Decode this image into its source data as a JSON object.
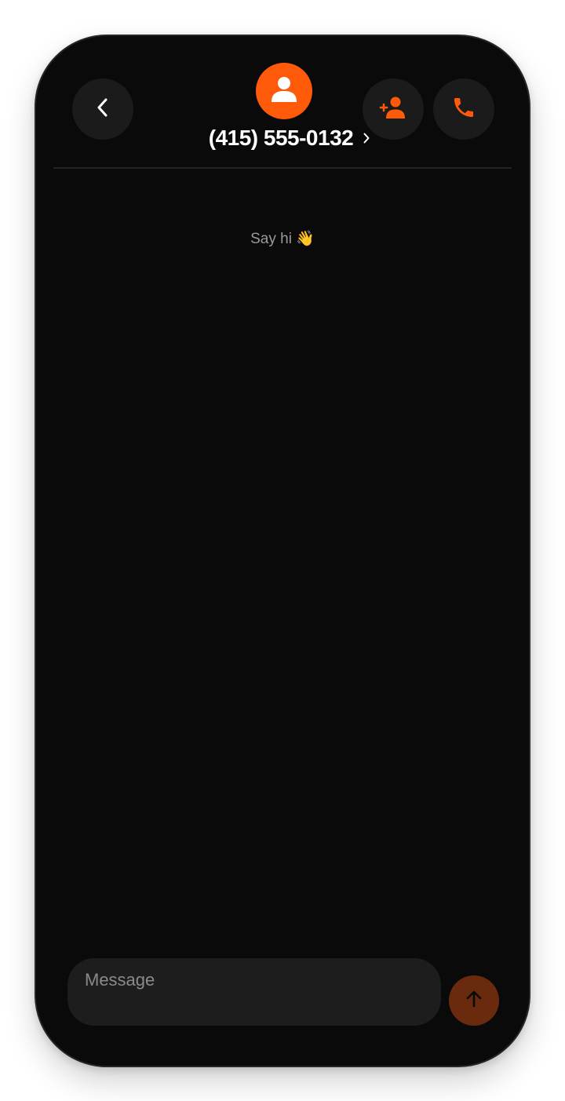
{
  "header": {
    "contact_name": "(415) 555-0132",
    "back_icon": "chevron-left-icon",
    "avatar_icon": "person-icon",
    "add_contact_icon": "person-add-icon",
    "call_icon": "phone-icon",
    "name_chevron_icon": "chevron-right-icon"
  },
  "conversation": {
    "empty_hint": "Say hi 👋"
  },
  "composer": {
    "placeholder": "Message",
    "value": "",
    "send_icon": "arrow-up-icon"
  },
  "colors": {
    "accent": "#ff5a0a",
    "background": "#0a0a0a",
    "button_bg": "#1b1b1c",
    "send_disabled": "#6a2a0e"
  }
}
